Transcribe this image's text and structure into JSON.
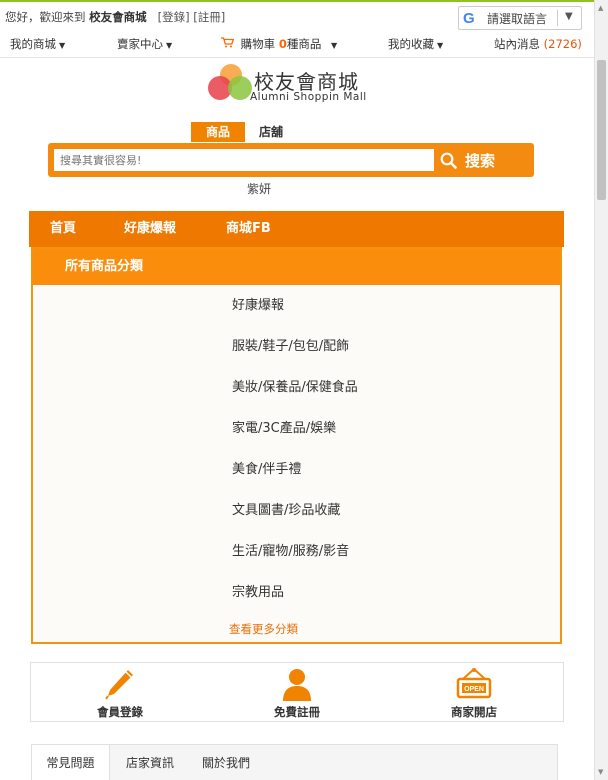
{
  "topbar": {
    "greeting": "您好，歡迎來到",
    "site_name": "校友會商城",
    "login": "[登錄]",
    "register": "[註冊]",
    "translate_label": "請選取語言",
    "nav": {
      "my_mall": "我的商城",
      "seller_center": "賣家中心",
      "cart_prefix": "購物車",
      "cart_count": "0",
      "cart_suffix": "種商品",
      "favorites": "我的收藏",
      "messages": "站內消息",
      "message_count": "(2726)"
    }
  },
  "logo": {
    "name": "校友會商城",
    "tagline": "Alumni Shoppin Mall"
  },
  "search": {
    "tabs": [
      "商品",
      "店舖"
    ],
    "placeholder": "搜尋其實很容易!",
    "button": "搜索",
    "hot_keyword": "紫妍"
  },
  "main_nav": {
    "items": [
      "首頁",
      "好康爆報",
      "商城FB"
    ]
  },
  "categories": {
    "header": "所有商品分類",
    "items": [
      "好康爆報",
      "服裝/鞋子/包包/配飾",
      "美妝/保養品/保健食品",
      "家電/3C產品/娛樂",
      "美食/伴手禮",
      "文具圖書/珍品收藏",
      "生活/寵物/服務/影音",
      "宗教用品"
    ],
    "more": "查看更多分類"
  },
  "services": {
    "items": [
      {
        "label": "會員登錄",
        "icon": "pen-icon"
      },
      {
        "label": "免費註冊",
        "icon": "person-icon"
      },
      {
        "label": "商家開店",
        "icon": "open-sign-icon"
      }
    ]
  },
  "info_tabs": {
    "items": [
      "常見問題",
      "店家資訊",
      "關於我們"
    ]
  },
  "colors": {
    "accent": "#f08300",
    "nav_bar": "#ee7800",
    "top_border": "#8fc31f"
  }
}
